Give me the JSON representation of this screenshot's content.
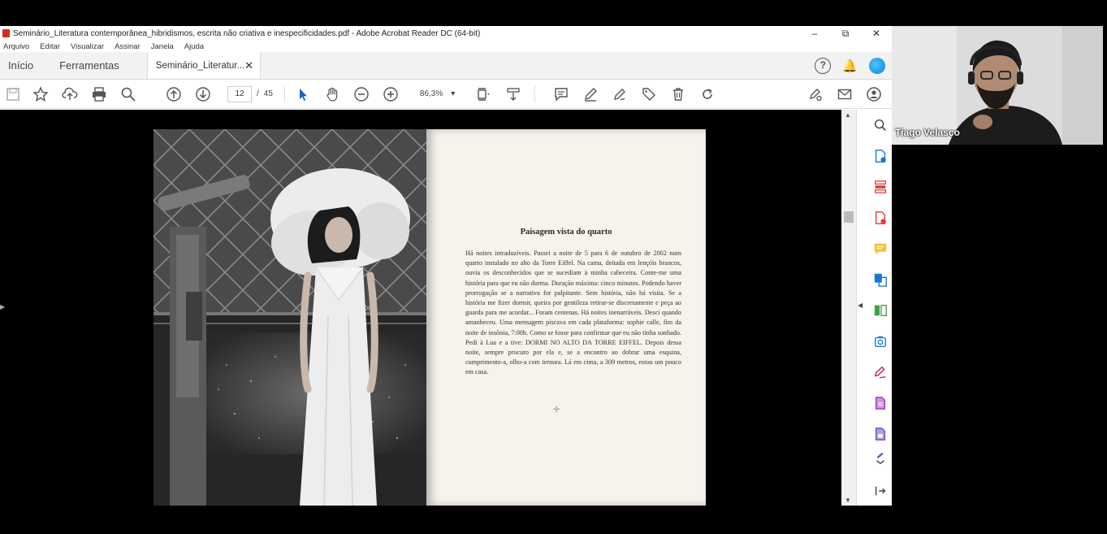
{
  "window": {
    "title": "Seminário_Literatura contemporânea_hibridismos, escrita não criativa e inespecificidades.pdf - Adobe Acrobat Reader DC (64-bit)",
    "controls": {
      "minimize": "–",
      "restore": "⧉",
      "close": "✕"
    }
  },
  "menu": [
    "Arquivo",
    "Editar",
    "Visualizar",
    "Assinar",
    "Janela",
    "Ajuda"
  ],
  "tabs": {
    "home": "Início",
    "tools": "Ferramentas",
    "document": "Seminário_Literatur...",
    "close": "✕"
  },
  "header_icons": {
    "help": "?",
    "notifications": "🔔"
  },
  "toolbar": {
    "page_current": "12",
    "page_sep": "/",
    "page_total": "45",
    "zoom": "86,3%",
    "zoom_caret": "▾"
  },
  "book": {
    "title": "Paisagem vista do quarto",
    "body": "Há noites intraduzíveis. Passei a noite de 5 para 6 de outubro de 2002 num quarto instalado no alto da Torre Eiffel. Na cama, deitada em lençóis brancos, ouvia os desconhecidos que se sucediam à minha cabeceira. Conte-me uma história para que eu não durma. Duração máxima: cinco minutos. Podendo haver prorrogação se a narrativa for palpitante. Sem história, não há visita. Se a história me fizer dormir, queira por gentileza retirar-se discretamente e peça ao guarda para me acordar... Foram centenas. Há noites inenarráveis. Desci quando amanheceu. Uma mensagem piscava em cada plataforma: sophie calle, fim da noite de insônia, 7:00h. Como se fosse para confirmar que eu não tinha sonhado. Pedi à Lua e a tive: DORMI NO ALTO DA TORRE EIFFEL. Depois dessa noite, sempre procuro por ela e, se a encontro ao dobrar uma esquina, cumprimento-a, olho-a com ternura. Lá em cima, a 309 metros, estou um pouco em casa."
  },
  "webcam": {
    "name": "Tiago Velasco"
  },
  "colors": {
    "accent_blue": "#0a84e0",
    "acrobat_red": "#d7281e",
    "tool_pink": "#c2185b"
  }
}
